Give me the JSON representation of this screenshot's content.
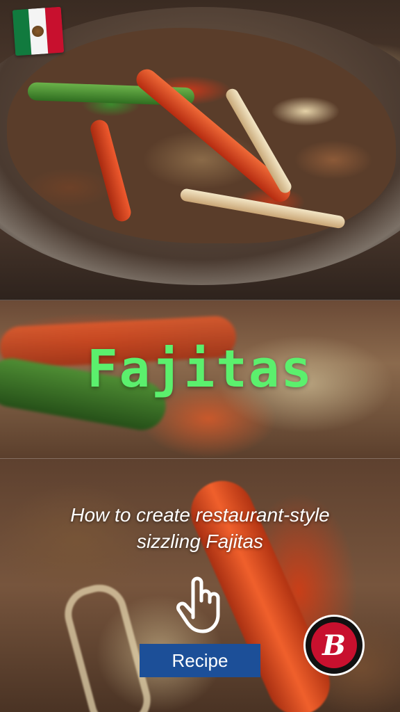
{
  "flag": {
    "icon": "mexico-flag-icon",
    "colors": [
      "#117a3e",
      "#f4f4f4",
      "#c8102e"
    ]
  },
  "title": "Fajitas",
  "subtitle": "How to create restaurant-style sizzling Fajitas",
  "pointer": {
    "icon": "pointing-hand-icon"
  },
  "cta": {
    "label": "Recipe",
    "color": "#1c4f98"
  },
  "logo": {
    "letter": "B",
    "icon": "brand-logo-icon",
    "color": "#c8102e"
  },
  "accent": {
    "title_color": "#5bf06d"
  }
}
